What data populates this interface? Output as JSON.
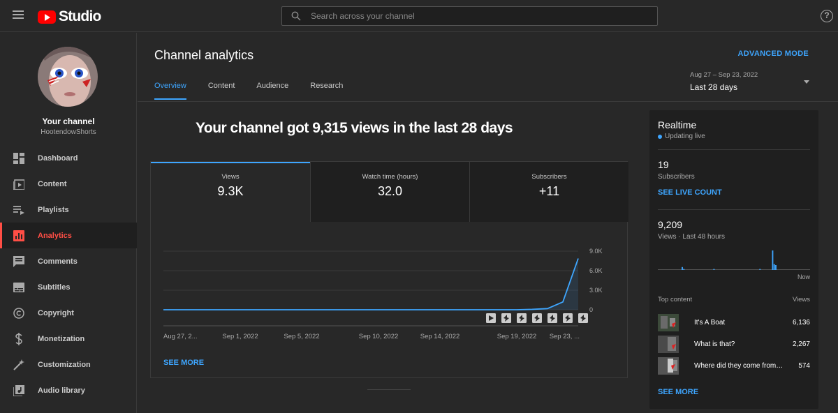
{
  "header": {
    "logo_text": "Studio",
    "search_placeholder": "Search across your channel",
    "help_icon_text": "?"
  },
  "sidebar": {
    "channel_title": "Your channel",
    "channel_name": "HootendowShorts",
    "items": [
      {
        "label": "Dashboard",
        "icon": "dashboard-icon"
      },
      {
        "label": "Content",
        "icon": "content-icon"
      },
      {
        "label": "Playlists",
        "icon": "playlists-icon"
      },
      {
        "label": "Analytics",
        "icon": "analytics-icon",
        "active": true
      },
      {
        "label": "Comments",
        "icon": "comments-icon"
      },
      {
        "label": "Subtitles",
        "icon": "subtitles-icon"
      },
      {
        "label": "Copyright",
        "icon": "copyright-icon"
      },
      {
        "label": "Monetization",
        "icon": "monetization-icon"
      },
      {
        "label": "Customization",
        "icon": "customization-icon"
      },
      {
        "label": "Audio library",
        "icon": "audio-library-icon"
      }
    ]
  },
  "main": {
    "title": "Channel analytics",
    "advanced_mode": "ADVANCED MODE",
    "tabs": [
      "Overview",
      "Content",
      "Audience",
      "Research"
    ],
    "active_tab": "Overview",
    "date_range": {
      "dates": "Aug 27 – Sep 23, 2022",
      "label": "Last 28 days"
    },
    "headline": "Your channel got 9,315 views in the last 28 days",
    "metrics": [
      {
        "label": "Views",
        "value": "9.3K",
        "selected": true
      },
      {
        "label": "Watch time (hours)",
        "value": "32.0"
      },
      {
        "label": "Subscribers",
        "value": "+11"
      }
    ],
    "see_more": "SEE MORE"
  },
  "chart_data": {
    "type": "line",
    "x": [
      "Aug 27",
      "Aug 28",
      "Aug 29",
      "Aug 30",
      "Aug 31",
      "Sep 1",
      "Sep 2",
      "Sep 3",
      "Sep 4",
      "Sep 5",
      "Sep 6",
      "Sep 7",
      "Sep 8",
      "Sep 9",
      "Sep 10",
      "Sep 11",
      "Sep 12",
      "Sep 13",
      "Sep 14",
      "Sep 15",
      "Sep 16",
      "Sep 17",
      "Sep 18",
      "Sep 19",
      "Sep 20",
      "Sep 21",
      "Sep 22",
      "Sep 23"
    ],
    "values": [
      0,
      0,
      0,
      0,
      0,
      0,
      0,
      0,
      0,
      0,
      0,
      0,
      0,
      0,
      0,
      0,
      0,
      0,
      0,
      0,
      0,
      0,
      0,
      0,
      60,
      180,
      1200,
      7875
    ],
    "x_tick_labels": [
      "Aug 27, 2...",
      "Sep 1, 2022",
      "Sep 5, 2022",
      "Sep 10, 2022",
      "Sep 14, 2022",
      "Sep 19, 2022",
      "Sep 23, ..."
    ],
    "x_tick_index": [
      0,
      5,
      9,
      14,
      18,
      23,
      27
    ],
    "y_ticks": [
      0,
      3000,
      6000,
      9000
    ],
    "y_tick_labels": [
      "0",
      "3.0K",
      "6.0K",
      "9.0K"
    ],
    "ylim": [
      0,
      9000
    ],
    "grid": true,
    "color": "#3ea6ff",
    "markers": [
      "video-marker-icon",
      "short-marker-icon",
      "short-marker-icon",
      "short-marker-icon",
      "short-marker-icon",
      "short-marker-icon",
      "short-marker-icon"
    ]
  },
  "realtime": {
    "title": "Realtime",
    "status": "Updating live",
    "subscribers_value": "19",
    "subscribers_label": "Subscribers",
    "see_live_count": "SEE LIVE COUNT",
    "views_value": "9,209",
    "views_label": "Views · Last 48 hours",
    "now_label": "Now",
    "top_content_label": "Top content",
    "views_col_label": "Views",
    "bars": [
      0,
      0,
      0,
      0,
      0,
      0,
      0,
      0,
      0,
      0,
      0,
      0,
      0,
      0,
      0,
      0.15,
      0.05,
      0,
      0,
      0,
      0,
      0,
      0,
      0,
      0,
      0,
      0,
      0,
      0,
      0,
      0,
      0,
      0,
      0,
      0,
      0.05,
      0,
      0,
      0,
      0,
      0,
      0,
      0,
      0,
      0,
      0,
      0,
      0,
      0,
      0,
      0,
      0,
      0,
      0,
      0,
      0,
      0,
      0,
      0,
      0,
      0,
      0,
      0,
      0,
      0.05,
      0,
      0,
      0,
      0,
      0,
      0,
      0,
      1.0,
      0.3,
      0.25,
      0,
      0,
      0,
      0,
      0,
      0,
      0,
      0,
      0,
      0,
      0,
      0,
      0,
      0,
      0,
      0,
      0,
      0,
      0,
      0,
      0
    ],
    "top_content": [
      {
        "title": "It's A Boat",
        "views": "6,136"
      },
      {
        "title": "What is that?",
        "views": "2,267"
      },
      {
        "title": "Where did they come from.....",
        "views": "574"
      }
    ],
    "see_more": "SEE MORE"
  }
}
